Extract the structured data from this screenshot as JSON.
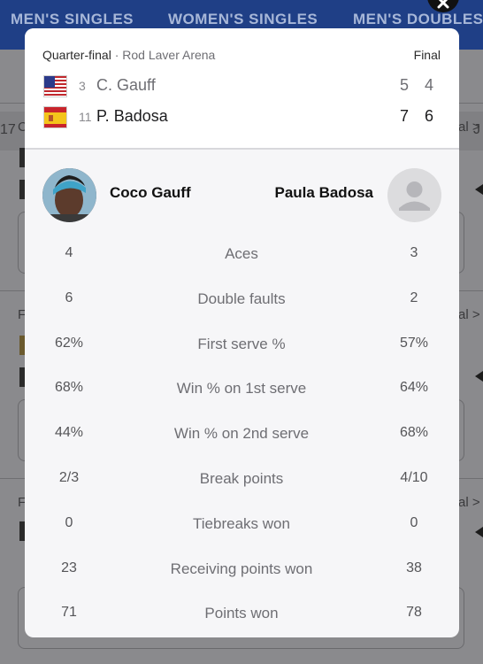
{
  "background": {
    "tabs": [
      "MEN'S SINGLES",
      "WOMEN'S SINGLES",
      "MEN'S DOUBLES"
    ],
    "date_left": "17",
    "date_right": "J",
    "card_prefixes": [
      "C",
      "F",
      "F"
    ],
    "card_suffix": "al >"
  },
  "match": {
    "round": "Quarter-final",
    "separator": "·",
    "venue": "Rod Laver Arena",
    "status": "Final",
    "players": [
      {
        "seed": "3",
        "name": "C. Gauff",
        "country": "USA",
        "sets": [
          "5",
          "4"
        ],
        "winner": false
      },
      {
        "seed": "11",
        "name": "P. Badosa",
        "country": "ESP",
        "sets": [
          "7",
          "6"
        ],
        "winner": true
      }
    ]
  },
  "player_left": {
    "full_name": "Coco Gauff",
    "avatar": "player-photo"
  },
  "player_right": {
    "full_name": "Paula Badosa",
    "avatar": "person-placeholder-icon"
  },
  "stats": [
    {
      "label": "Aces",
      "left": "4",
      "right": "3"
    },
    {
      "label": "Double faults",
      "left": "6",
      "right": "2"
    },
    {
      "label": "First serve %",
      "left": "62%",
      "right": "57%"
    },
    {
      "label": "Win % on 1st serve",
      "left": "68%",
      "right": "64%"
    },
    {
      "label": "Win % on 2nd serve",
      "left": "44%",
      "right": "68%"
    },
    {
      "label": "Break points",
      "left": "2/3",
      "right": "4/10"
    },
    {
      "label": "Tiebreaks won",
      "left": "0",
      "right": "0"
    },
    {
      "label": "Receiving points won",
      "left": "23",
      "right": "38"
    },
    {
      "label": "Points won",
      "left": "71",
      "right": "78"
    }
  ],
  "colors": {
    "header_bg": "#1f3f86",
    "tab_text": "#a7b7d8",
    "modal_bg": "#f6f6f8"
  }
}
